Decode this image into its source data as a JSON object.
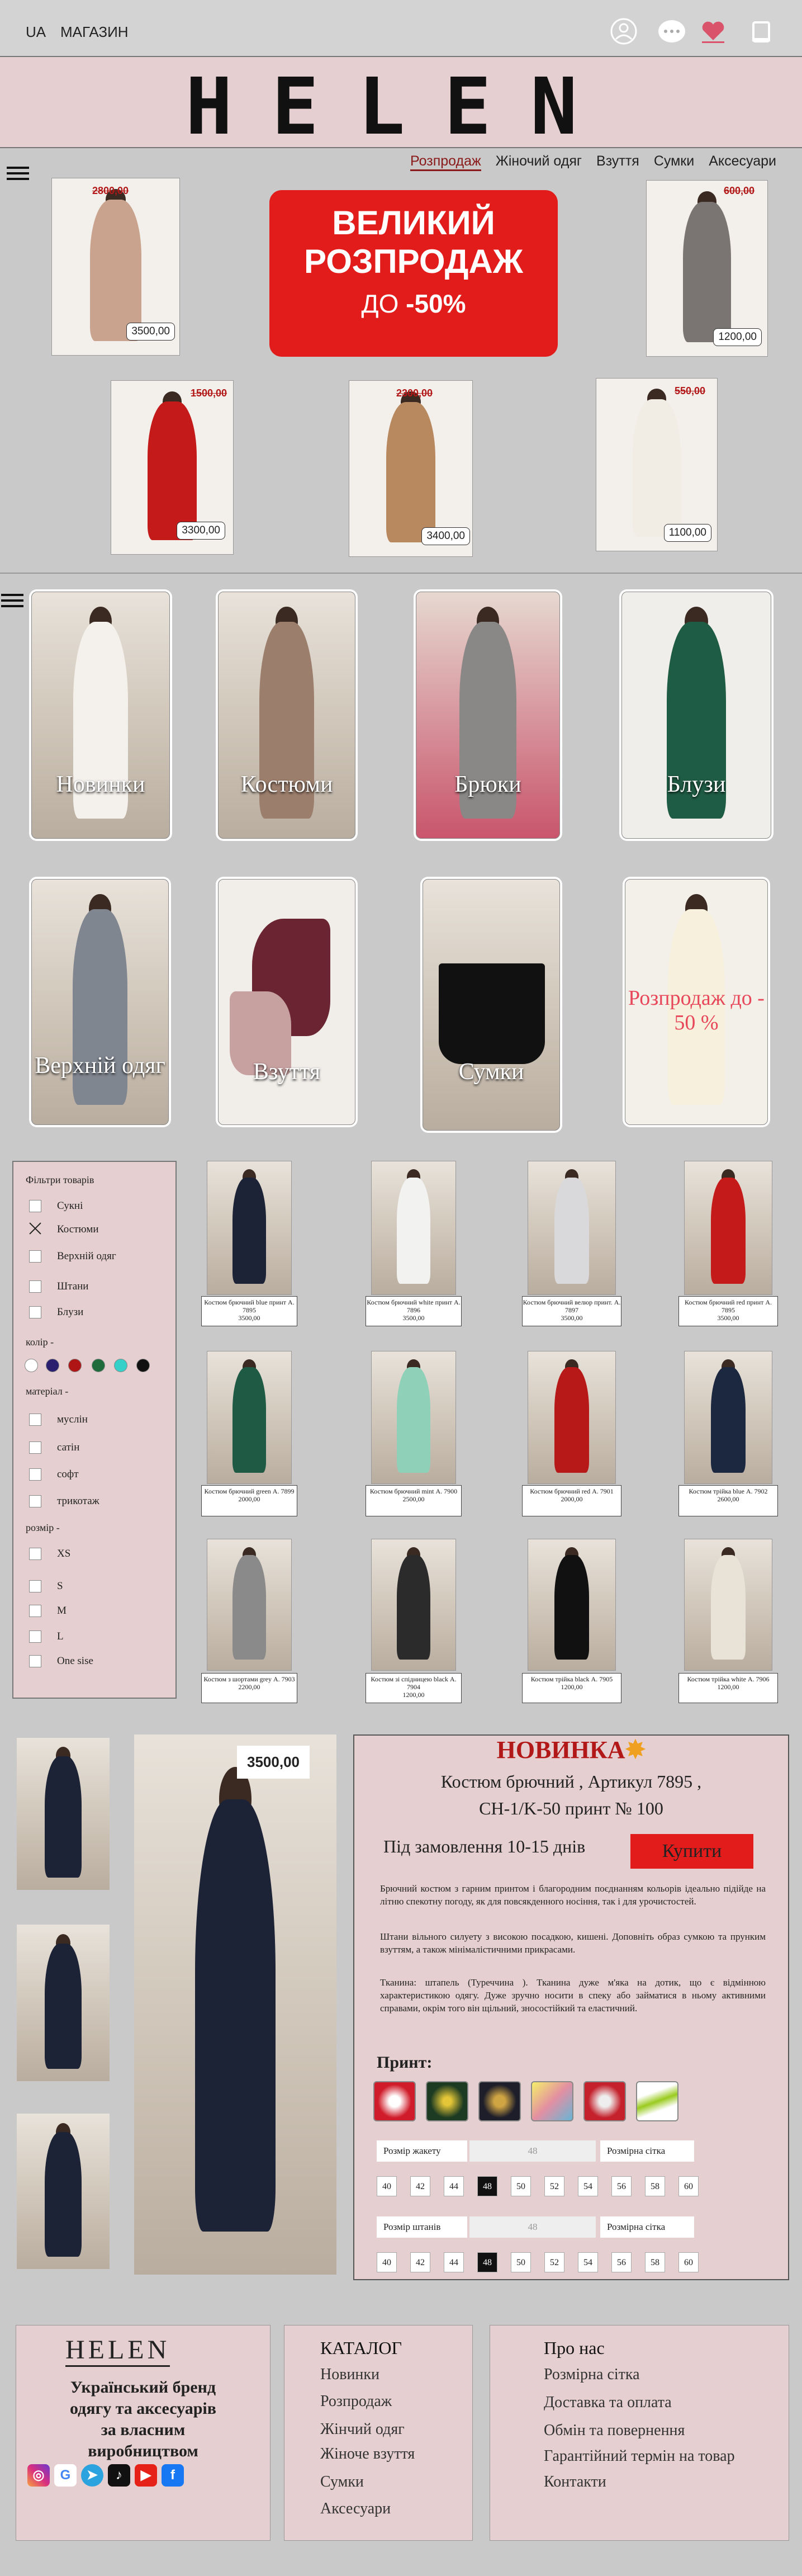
{
  "header": {
    "lang": "UA",
    "shop": "МАГАЗИН",
    "logo": "HELEN"
  },
  "nav": {
    "items": [
      "Розпродаж",
      "Жіночий одяг",
      "Взуття",
      "Сумки",
      "Аксесуари"
    ]
  },
  "banner": {
    "line1": "ВЕЛИКИЙ",
    "line2": "РОЗПРОДАЖ",
    "prefix": "ДО",
    "discount": "-50%"
  },
  "sale_items": [
    {
      "old": "2800,00",
      "new": "3500,00"
    },
    {
      "old": "600,00",
      "new": "1200,00"
    },
    {
      "old": "1500,00",
      "new": "3300,00"
    },
    {
      "old": "2300,00",
      "new": "3400,00"
    },
    {
      "old": "550,00",
      "new": "1100,00"
    }
  ],
  "categories": [
    {
      "label": "Новинки"
    },
    {
      "label": "Костюми"
    },
    {
      "label": "Брюки"
    },
    {
      "label": "Блузи"
    },
    {
      "label": "Верхній одяг"
    },
    {
      "label": "Взуття"
    },
    {
      "label": "Сумки"
    },
    {
      "label": "Розпродаж до - 50 %"
    }
  ],
  "filter": {
    "title": "Фільтри товарів",
    "types": [
      "Сукні",
      "Костюми",
      "Верхній одяг",
      "Штани",
      "Блузи"
    ],
    "color_label": "колір -",
    "colors": [
      "#ffffff",
      "#2a1e6e",
      "#b01515",
      "#1f6b3c",
      "#35d0c8",
      "#111111"
    ],
    "material_label": "матеріал -",
    "materials": [
      "муслін",
      "сатін",
      "софт",
      "трикотаж"
    ],
    "size_label": "розмір -",
    "sizes": [
      "XS",
      "S",
      "M",
      "L",
      "One sise"
    ]
  },
  "products": [
    {
      "name": "Костюм брючний blue принт А. 7895",
      "price": "3500,00"
    },
    {
      "name": "Костюм брючний white принт А. 7896",
      "price": "3500,00"
    },
    {
      "name": "Костюм брючний велюр принт. А. 7897",
      "price": "3500,00"
    },
    {
      "name": "Костюм брючний red принт А. 7895",
      "price": "3500,00"
    },
    {
      "name": "Костюм брючний green А. 7899",
      "price": "2000,00"
    },
    {
      "name": "Костюм брючний mint А. 7900",
      "price": "2500,00"
    },
    {
      "name": "Костюм брючний red А. 7901",
      "price": "2000,00"
    },
    {
      "name": "Костюм трійка blue А. 7902",
      "price": "2600,00"
    },
    {
      "name": "Костюм з шортами grey А. 7903",
      "price": "2200,00"
    },
    {
      "name": "Костюм зі спідницею black А. 7904",
      "price": "1200,00"
    },
    {
      "name": "Костюм трійка black А. 7905",
      "price": "1200,00"
    },
    {
      "name": "Костюм трійка white А. 7906",
      "price": "1200,00"
    }
  ],
  "detail": {
    "price": "3500,00",
    "badge": "НОВИНКА",
    "title_line1": "Костюм брючний , Артикул 7895 ,",
    "title_line2": "CH-1/K-50 принт № 100",
    "order_note": "Під замовлення 10-15 днів",
    "buy": "Купити",
    "desc1": "Брючний костюм з гарним принтом і благородним поєднанням кольорів ідеально підійде на літню спекотну погоду, як для повсякденного носіння, так і для урочистостей.",
    "desc2": "Штани вільного силуету з високою посадкою, кишені. Доповніть образ сумкою та прунким взуттям, а також мінімалістичними прикрасами.",
    "desc3": "Тканина: штапель (Туреччина ). Тканина дуже м'яка на дотик, що є відмінною характеристикою одягу. Дуже зручно носити в спеку або займатися в ньому активними справами, окрім того він щільний, зносостійкий та еластичний.",
    "print_label": "Принт:",
    "jacket_label": "Розмір жакету",
    "jacket_value": "48",
    "grid_label": "Розмірна сітка",
    "pants_label": "Розмір штанів",
    "pants_value": "48",
    "grid_label2": "Розмірна сітка",
    "sizes": [
      "40",
      "42",
      "44",
      "48",
      "50",
      "52",
      "54",
      "56",
      "58",
      "60"
    ]
  },
  "footer": {
    "logo": "HELEN",
    "tagline": [
      "Український бренд",
      "одягу та аксесуарів",
      "за власним",
      "виробництвом"
    ],
    "catalog_title": "КАТАЛОГ",
    "catalog": [
      "Новинки",
      "Розпродаж",
      "Жінчий одяг",
      "Жіноче взуття",
      "Сумки",
      "Аксесуари"
    ],
    "about_title": "Про нас",
    "about": [
      "Розмірна сітка",
      "Доставка та оплата",
      "Обмін та повернення",
      "Гарантійний термін на товар",
      "Контакти"
    ]
  },
  "colors": {
    "brand_pink": "#e6cfd0",
    "sale_red": "#e21b1b",
    "accent_dark_red": "#8a1a1a"
  }
}
